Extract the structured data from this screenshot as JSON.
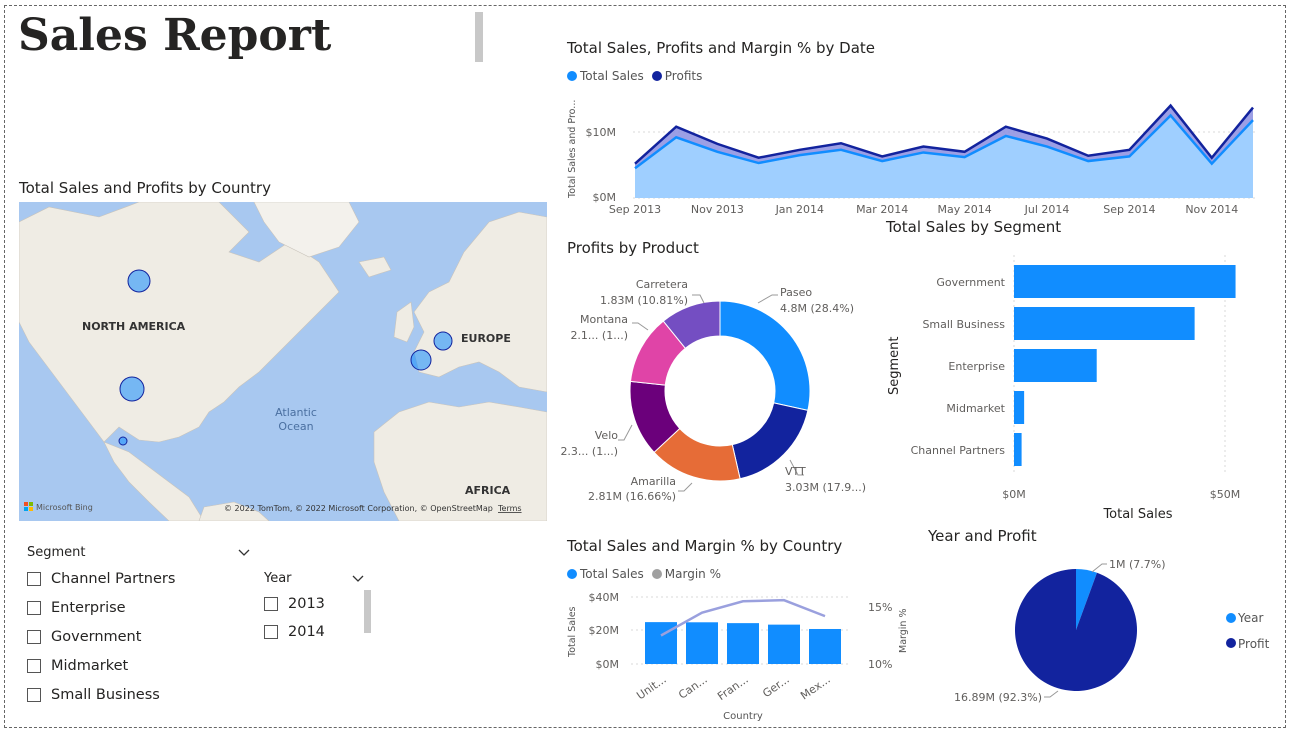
{
  "report": {
    "title": "Sales Report"
  },
  "line_chart": {
    "title": "Total Sales, Profits and Margin % by Date",
    "legend": [
      {
        "label": "Total Sales",
        "color": "#118DFF"
      },
      {
        "label": "Profits",
        "color": "#12239E"
      }
    ],
    "ylabel": "Total Sales and Pro...",
    "y_ticks": [
      "$10M",
      "$0M"
    ],
    "x_ticks": [
      "Sep 2013",
      "Nov 2013",
      "Jan 2014",
      "Mar 2014",
      "May 2014",
      "Jul 2014",
      "Sep 2014",
      "Nov 2014"
    ]
  },
  "map": {
    "title": "Total Sales and Profits by Country",
    "labels": {
      "north_america": "NORTH AMERICA",
      "europe": "EUROPE",
      "ocean": "Atlantic Ocean",
      "africa": "AFRICA"
    },
    "bing": "Microsoft Bing",
    "copyright": "© 2022 TomTom, © 2022 Microsoft Corporation, © OpenStreetMap",
    "terms": "Terms",
    "bubble_color": "#118DFF"
  },
  "donut": {
    "title": "Profits by Product",
    "labels": [
      {
        "name": "Paseo",
        "value": "4.8M (28.4%)"
      },
      {
        "name": "VTT",
        "value": "3.03M (17.9...)"
      },
      {
        "name": "Amarilla",
        "value": "2.81M (16.66%)"
      },
      {
        "name": "Velo",
        "value": "2.3... (1...)"
      },
      {
        "name": "Montana",
        "value": "2.1... (1...)"
      },
      {
        "name": "Carretera",
        "value": "1.83M (10.81%)"
      }
    ]
  },
  "segment_bar": {
    "title": "Total Sales by Segment",
    "ylabel": "Segment",
    "xlabel": "Total Sales",
    "x_ticks": [
      "$0M",
      "$50M"
    ]
  },
  "country_combo": {
    "title": "Total Sales and Margin % by Country",
    "legend": [
      {
        "label": "Total Sales",
        "color": "#118DFF"
      },
      {
        "label": "Margin %",
        "color": "#A0A0A0"
      }
    ],
    "ylabel": "Total Sales",
    "y2label": "Margin %",
    "xlabel": "Country",
    "y_ticks": [
      "$40M",
      "$20M",
      "$0M"
    ],
    "y2_ticks": [
      "15%",
      "10%"
    ]
  },
  "pie": {
    "title": "Year and Profit",
    "labels": {
      "year": "1M (7.7%)",
      "profit": "16.89M (92.3%)"
    },
    "legend": [
      {
        "label": "Year",
        "color": "#118DFF"
      },
      {
        "label": "Profit",
        "color": "#12239E"
      }
    ]
  },
  "segment_slicer": {
    "title": "Segment",
    "items": [
      "Channel Partners",
      "Enterprise",
      "Government",
      "Midmarket",
      "Small Business"
    ]
  },
  "year_slicer": {
    "title": "Year",
    "items": [
      "2013",
      "2014"
    ]
  },
  "chart_data": [
    {
      "type": "area",
      "title": "Total Sales, Profits and Margin % by Date",
      "x": [
        "Sep 2013",
        "Oct 2013",
        "Nov 2013",
        "Dec 2013",
        "Jan 2014",
        "Feb 2014",
        "Mar 2014",
        "Apr 2014",
        "May 2014",
        "Jun 2014",
        "Jul 2014",
        "Aug 2014",
        "Sep 2014",
        "Oct 2014",
        "Nov 2014",
        "Dec 2014"
      ],
      "series": [
        {
          "name": "Total Sales",
          "values": [
            4.5,
            9.2,
            7.0,
            5.3,
            6.5,
            7.3,
            5.6,
            6.9,
            6.2,
            9.4,
            7.8,
            5.6,
            6.3,
            12.5,
            5.2,
            11.8
          ]
        },
        {
          "name": "Profits",
          "values": [
            5.2,
            10.8,
            8.2,
            6.1,
            7.3,
            8.3,
            6.3,
            7.8,
            7.0,
            10.8,
            9.0,
            6.4,
            7.3,
            14.0,
            6.1,
            13.7
          ]
        }
      ],
      "ylabel": "Total Sales and Pro...",
      "ylim": [
        0,
        15
      ]
    },
    {
      "type": "pie",
      "title": "Profits by Product",
      "categories": [
        "Paseo",
        "VTT",
        "Amarilla",
        "Velo",
        "Montana",
        "Carretera"
      ],
      "values": [
        4.8,
        3.03,
        2.81,
        2.3,
        2.1,
        1.83
      ],
      "colors": [
        "#118DFF",
        "#12239E",
        "#E66C37",
        "#6B007B",
        "#E044A7",
        "#744EC2"
      ]
    },
    {
      "type": "bar",
      "title": "Total Sales by Segment",
      "categories": [
        "Government",
        "Small Business",
        "Enterprise",
        "Midmarket",
        "Channel Partners"
      ],
      "values": [
        52.5,
        42.8,
        19.6,
        2.4,
        1.8
      ],
      "xlabel": "Total Sales",
      "ylabel": "Segment",
      "xlim": [
        0,
        60
      ]
    },
    {
      "type": "bar",
      "title": "Total Sales and Margin % by Country",
      "categories": [
        "Unit...",
        "Can...",
        "Fran...",
        "Ger...",
        "Mex..."
      ],
      "series": [
        {
          "name": "Total Sales",
          "values": [
            25.0,
            24.9,
            24.4,
            23.5,
            20.9
          ]
        },
        {
          "name": "Margin %",
          "values": [
            12.5,
            14.5,
            15.5,
            15.6,
            14.2
          ]
        }
      ],
      "ylim": [
        0,
        40
      ],
      "y2lim": [
        10,
        16
      ],
      "xlabel": "Country"
    },
    {
      "type": "pie",
      "title": "Year and Profit",
      "categories": [
        "Year",
        "Profit"
      ],
      "values": [
        1,
        16.89
      ],
      "colors": [
        "#118DFF",
        "#12239E"
      ]
    }
  ]
}
